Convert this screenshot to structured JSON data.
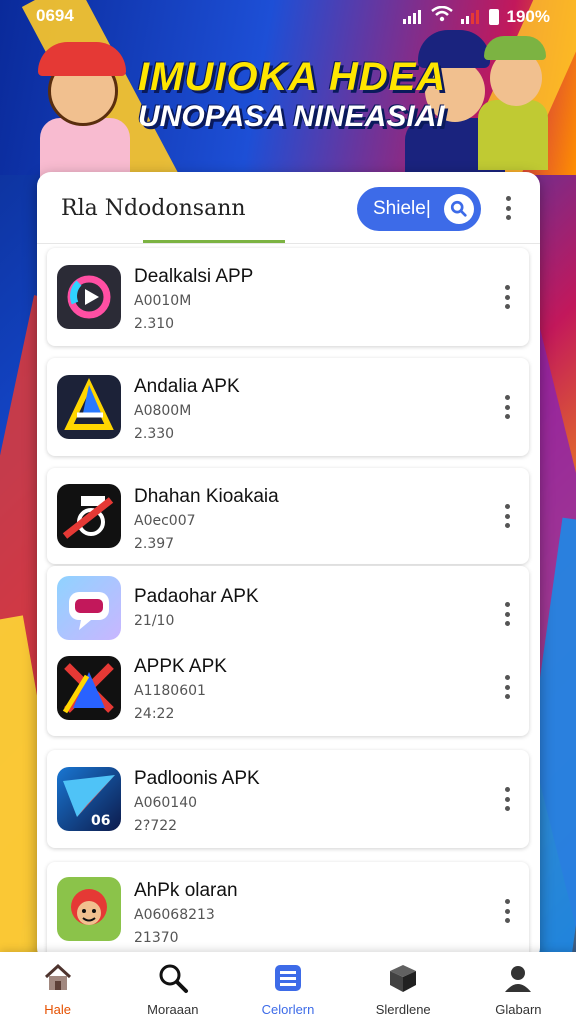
{
  "status_bar": {
    "time": "0694",
    "battery": "190%"
  },
  "banner": {
    "title": "IMUIOKA HDEA",
    "subtitle": "UNOPASA NINEASIAI"
  },
  "header": {
    "title": "Rla Ndodonsann",
    "search_label": "Shiele|"
  },
  "apps": [
    {
      "name": "Dealkalsi APP",
      "line1": "A0010M",
      "line2": "2.310"
    },
    {
      "name": "Andalia APK",
      "line1": "A0800M",
      "line2": "2.330"
    },
    {
      "name": "Dhahan Kioakaia",
      "line1": "A0ec007",
      "line2": "2.397"
    },
    {
      "name": "Padaohar APK",
      "line1": "",
      "line2": "21/10"
    },
    {
      "name": "APPK APK",
      "line1": "A1180601",
      "line2": "24:22"
    },
    {
      "name": "Padloonis APK",
      "line1": "A060140",
      "line2": "2?722"
    },
    {
      "name": "AhPk olaran",
      "line1": "A06068213",
      "line2": "21370"
    }
  ],
  "nav": [
    {
      "label": "Hale",
      "icon": "home-icon"
    },
    {
      "label": "Moraaan",
      "icon": "search-icon"
    },
    {
      "label": "Celorlern",
      "icon": "list-icon"
    },
    {
      "label": "Slerdlene",
      "icon": "box-icon"
    },
    {
      "label": "Glabarn",
      "icon": "profile-icon"
    }
  ],
  "colors": {
    "accent": "#3d6be8",
    "home_active": "#e65100",
    "underline": "#7cb342"
  }
}
